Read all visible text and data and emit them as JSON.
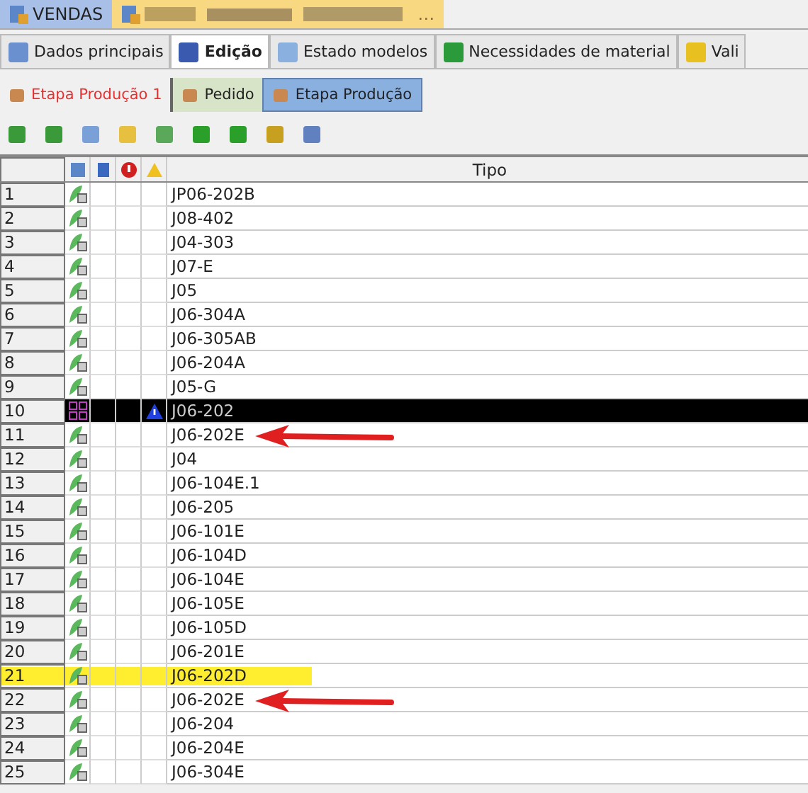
{
  "document_tabs": [
    {
      "label": "VENDAS",
      "selected": false,
      "kind": "plain"
    },
    {
      "label": "…",
      "selected": true,
      "kind": "redacted"
    }
  ],
  "tabs": [
    {
      "label": "Dados principais",
      "selected": false
    },
    {
      "label": "Edição",
      "selected": true
    },
    {
      "label": "Estado modelos",
      "selected": false
    },
    {
      "label": "Necessidades de material",
      "selected": false
    },
    {
      "label": "Vali",
      "selected": false
    }
  ],
  "section_title": "Etapa Produção 1",
  "sub_tabs": [
    {
      "label": "Pedido",
      "selected": false
    },
    {
      "label": "Etapa Produção",
      "selected": true
    }
  ],
  "table": {
    "columns": [
      "Tipo"
    ],
    "rows": [
      {
        "number": "1",
        "tipo": "JP06-202B",
        "selected": false,
        "warning": false,
        "highlighted": false,
        "arrow": false
      },
      {
        "number": "2",
        "tipo": "J08-402",
        "selected": false,
        "warning": false,
        "highlighted": false,
        "arrow": false
      },
      {
        "number": "3",
        "tipo": "J04-303",
        "selected": false,
        "warning": false,
        "highlighted": false,
        "arrow": false
      },
      {
        "number": "4",
        "tipo": "J07-E",
        "selected": false,
        "warning": false,
        "highlighted": false,
        "arrow": false
      },
      {
        "number": "5",
        "tipo": "J05",
        "selected": false,
        "warning": false,
        "highlighted": false,
        "arrow": false
      },
      {
        "number": "6",
        "tipo": "J06-304A",
        "selected": false,
        "warning": false,
        "highlighted": false,
        "arrow": false
      },
      {
        "number": "7",
        "tipo": "J06-305AB",
        "selected": false,
        "warning": false,
        "highlighted": false,
        "arrow": false
      },
      {
        "number": "8",
        "tipo": "J06-204A",
        "selected": false,
        "warning": false,
        "highlighted": false,
        "arrow": false
      },
      {
        "number": "9",
        "tipo": "J05-G",
        "selected": false,
        "warning": false,
        "highlighted": false,
        "arrow": false
      },
      {
        "number": "10",
        "tipo": "J06-202",
        "selected": true,
        "warning": true,
        "highlighted": false,
        "arrow": false
      },
      {
        "number": "11",
        "tipo": "J06-202E",
        "selected": false,
        "warning": false,
        "highlighted": false,
        "arrow": true
      },
      {
        "number": "12",
        "tipo": "J04",
        "selected": false,
        "warning": false,
        "highlighted": false,
        "arrow": false
      },
      {
        "number": "13",
        "tipo": "J06-104E.1",
        "selected": false,
        "warning": false,
        "highlighted": false,
        "arrow": false
      },
      {
        "number": "14",
        "tipo": "J06-205",
        "selected": false,
        "warning": false,
        "highlighted": false,
        "arrow": false
      },
      {
        "number": "15",
        "tipo": "J06-101E",
        "selected": false,
        "warning": false,
        "highlighted": false,
        "arrow": false
      },
      {
        "number": "16",
        "tipo": "J06-104D",
        "selected": false,
        "warning": false,
        "highlighted": false,
        "arrow": false
      },
      {
        "number": "17",
        "tipo": "J06-104E",
        "selected": false,
        "warning": false,
        "highlighted": false,
        "arrow": false
      },
      {
        "number": "18",
        "tipo": "J06-105E",
        "selected": false,
        "warning": false,
        "highlighted": false,
        "arrow": false
      },
      {
        "number": "19",
        "tipo": "J06-105D",
        "selected": false,
        "warning": false,
        "highlighted": false,
        "arrow": false
      },
      {
        "number": "20",
        "tipo": "J06-201E",
        "selected": false,
        "warning": false,
        "highlighted": false,
        "arrow": false
      },
      {
        "number": "21",
        "tipo": "J06-202D",
        "selected": false,
        "warning": false,
        "highlighted": true,
        "arrow": false
      },
      {
        "number": "22",
        "tipo": "J06-202E",
        "selected": false,
        "warning": false,
        "highlighted": false,
        "arrow": true
      },
      {
        "number": "23",
        "tipo": "J06-204",
        "selected": false,
        "warning": false,
        "highlighted": false,
        "arrow": false
      },
      {
        "number": "24",
        "tipo": "J06-204E",
        "selected": false,
        "warning": false,
        "highlighted": false,
        "arrow": false
      },
      {
        "number": "25",
        "tipo": "J06-304E",
        "selected": false,
        "warning": false,
        "highlighted": false,
        "arrow": false
      }
    ]
  }
}
